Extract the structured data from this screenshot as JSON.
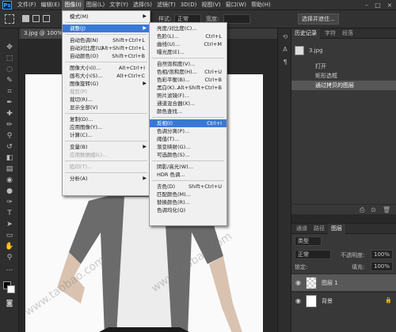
{
  "menubar": {
    "items": [
      "文件(F)",
      "编辑(E)",
      "图像(I)",
      "图层(L)",
      "文字(Y)",
      "选择(S)",
      "滤镜(T)",
      "3D(D)",
      "视图(V)",
      "窗口(W)",
      "帮助(H)"
    ],
    "active_index": 2
  },
  "options_bar": {
    "style_label": "样式:",
    "style_value": "正常",
    "width_label": "宽度:",
    "select_mask_button": "选择并遮住..."
  },
  "document": {
    "tab_label": "3.jpg @ 100% (图层 1, RGB/8)"
  },
  "image_menu": {
    "items": [
      {
        "label": "模式(M)",
        "submenu": true
      },
      {
        "sep": true
      },
      {
        "label": "调整(J)",
        "submenu": true,
        "highlight": true
      },
      {
        "sep": true
      },
      {
        "label": "自动色调(N)",
        "shortcut": "Shift+Ctrl+L"
      },
      {
        "label": "自动对比度(U)",
        "shortcut": "Alt+Shift+Ctrl+L"
      },
      {
        "label": "自动颜色(O)",
        "shortcut": "Shift+Ctrl+B"
      },
      {
        "sep": true
      },
      {
        "label": "图像大小(I)...",
        "shortcut": "Alt+Ctrl+I"
      },
      {
        "label": "画布大小(S)...",
        "shortcut": "Alt+Ctrl+C"
      },
      {
        "label": "图像旋转(G)",
        "submenu": true
      },
      {
        "label": "裁剪(P)",
        "disabled": true
      },
      {
        "label": "裁切(R)..."
      },
      {
        "label": "显示全部(V)"
      },
      {
        "sep": true
      },
      {
        "label": "复制(D)..."
      },
      {
        "label": "应用图像(Y)..."
      },
      {
        "label": "计算(C)..."
      },
      {
        "sep": true
      },
      {
        "label": "变量(B)",
        "submenu": true
      },
      {
        "label": "应用数据组(L)...",
        "disabled": true
      },
      {
        "sep": true
      },
      {
        "label": "陷印(T)...",
        "disabled": true
      },
      {
        "sep": true
      },
      {
        "label": "分析(A)",
        "submenu": true
      }
    ]
  },
  "adjust_menu": {
    "items": [
      {
        "label": "亮度/对比度(C)..."
      },
      {
        "label": "色阶(L)...",
        "shortcut": "Ctrl+L"
      },
      {
        "label": "曲线(U)...",
        "shortcut": "Ctrl+M"
      },
      {
        "label": "曝光度(E)..."
      },
      {
        "sep": true
      },
      {
        "label": "自然饱和度(V)..."
      },
      {
        "label": "色相/饱和度(H)...",
        "shortcut": "Ctrl+U"
      },
      {
        "label": "色彩平衡(B)...",
        "shortcut": "Ctrl+B"
      },
      {
        "label": "黑白(K)...",
        "shortcut": "Alt+Shift+Ctrl+B"
      },
      {
        "label": "照片滤镜(F)..."
      },
      {
        "label": "通道混合器(X)..."
      },
      {
        "label": "颜色查找..."
      },
      {
        "sep": true
      },
      {
        "label": "反相(I)",
        "shortcut": "Ctrl+I",
        "highlight": true
      },
      {
        "label": "色调分离(P)..."
      },
      {
        "label": "阈值(T)..."
      },
      {
        "label": "渐变映射(G)..."
      },
      {
        "label": "可选颜色(S)..."
      },
      {
        "sep": true
      },
      {
        "label": "阴影/高光(W)..."
      },
      {
        "label": "HDR 色调..."
      },
      {
        "sep": true
      },
      {
        "label": "去色(D)",
        "shortcut": "Shift+Ctrl+U"
      },
      {
        "label": "匹配颜色(M)..."
      },
      {
        "label": "替换颜色(R)..."
      },
      {
        "label": "色调均化(Q)"
      }
    ]
  },
  "history_panel": {
    "tabs": [
      "历史记录",
      "字符",
      "段落"
    ],
    "snapshot": "3.jpg",
    "steps": [
      "打开",
      "矩形选框",
      "通过拷贝的图层"
    ]
  },
  "layers_panel": {
    "tabs": [
      "通道",
      "路径",
      "图层"
    ],
    "kind_label": "类型",
    "blend_mode": "正常",
    "opacity_label": "不透明度:",
    "opacity_value": "100%",
    "lock_label": "锁定:",
    "fill_label": "填充:",
    "fill_value": "100%",
    "layers": [
      "图层 1",
      "背景"
    ]
  },
  "watermark": "www.taobao.com"
}
